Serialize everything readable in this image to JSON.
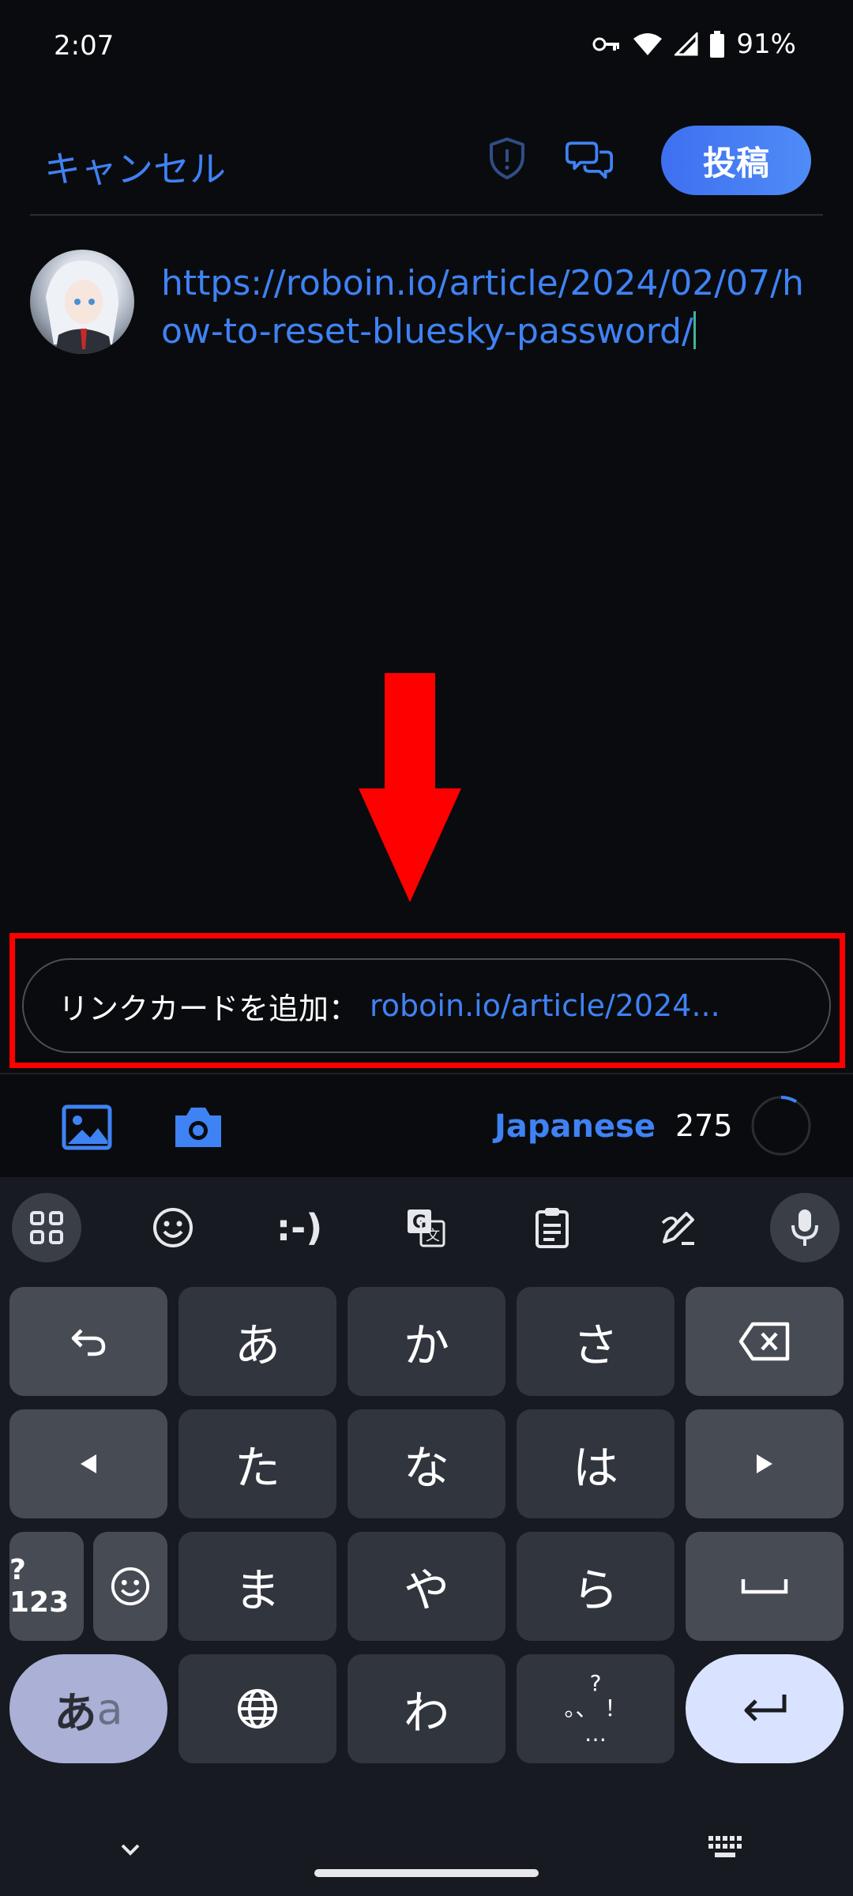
{
  "status": {
    "time": "2:07",
    "battery": "91%"
  },
  "header": {
    "cancel_label": "キャンセル",
    "post_label": "投稿"
  },
  "compose": {
    "text": "https://roboin.io/article/2024/02/07/how-to-reset-bluesky-password/"
  },
  "link_card": {
    "label": "リンクカードを追加：",
    "url": "roboin.io/article/2024..."
  },
  "toolbar": {
    "language": "Japanese",
    "remaining": "275"
  },
  "keyboard": {
    "suggestions": {
      "emoticon": ":-)"
    },
    "keys": {
      "a": "あ",
      "ka": "か",
      "sa": "さ",
      "ta": "た",
      "na": "な",
      "ha": "は",
      "sym": "?123",
      "ma": "ま",
      "ya": "や",
      "ra": "ら",
      "aa_main": "あ",
      "aa_sub": "a",
      "wa": "わ",
      "punct_top": "?",
      "punct_mid": "。、 ！",
      "punct_bottom": "…"
    }
  },
  "colors": {
    "accent": "#3f82f4",
    "highlight": "#ff0000",
    "background": "#0a0b0e"
  }
}
